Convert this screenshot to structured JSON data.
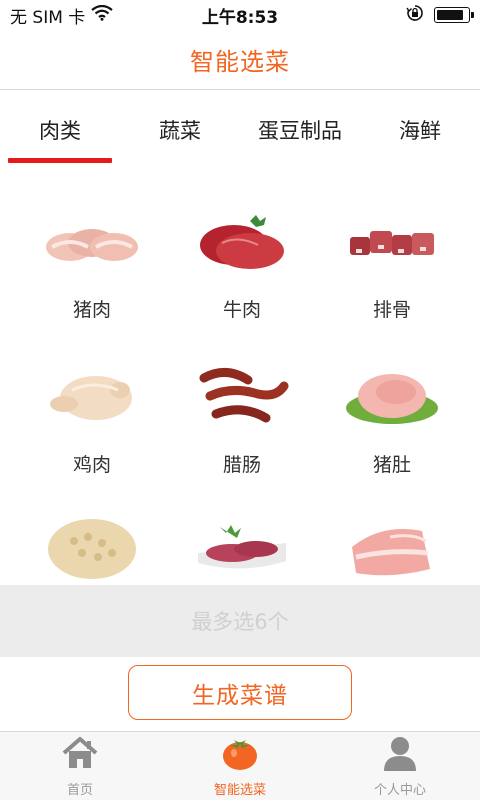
{
  "status_bar": {
    "carrier": "无 SIM 卡",
    "time": "上午8:53",
    "wifi_icon": "wifi-icon",
    "orientation_lock_icon": "orientation-lock-icon",
    "battery_icon": "battery-icon",
    "battery_level": 0.85
  },
  "header": {
    "title": "智能选菜"
  },
  "tabs": [
    {
      "label": "肉类",
      "active": true
    },
    {
      "label": "蔬菜",
      "active": false
    },
    {
      "label": "蛋豆制品",
      "active": false
    },
    {
      "label": "海鲜",
      "active": false
    }
  ],
  "items": [
    {
      "label": "猪肉",
      "icon": "pork-chops-image"
    },
    {
      "label": "牛肉",
      "icon": "beef-steak-image"
    },
    {
      "label": "排骨",
      "icon": "pork-ribs-image"
    },
    {
      "label": "鸡肉",
      "icon": "chicken-image"
    },
    {
      "label": "腊肠",
      "icon": "sausage-image"
    },
    {
      "label": "猪肚",
      "icon": "pork-belly-image"
    },
    {
      "label": "",
      "icon": "tripe-image"
    },
    {
      "label": "",
      "icon": "ham-slices-image"
    },
    {
      "label": "",
      "icon": "pork-cut-image"
    }
  ],
  "limit_text": "最多选6个",
  "generate_label": "生成菜谱",
  "bottom_nav": [
    {
      "label": "首页",
      "icon": "home-icon",
      "active": false
    },
    {
      "label": "智能选菜",
      "icon": "tomato-icon",
      "active": true
    },
    {
      "label": "个人中心",
      "icon": "person-icon",
      "active": false
    }
  ],
  "colors": {
    "accent": "#f26522",
    "tab_indicator": "#e8191a",
    "limit_bar_bg": "#ececec"
  }
}
